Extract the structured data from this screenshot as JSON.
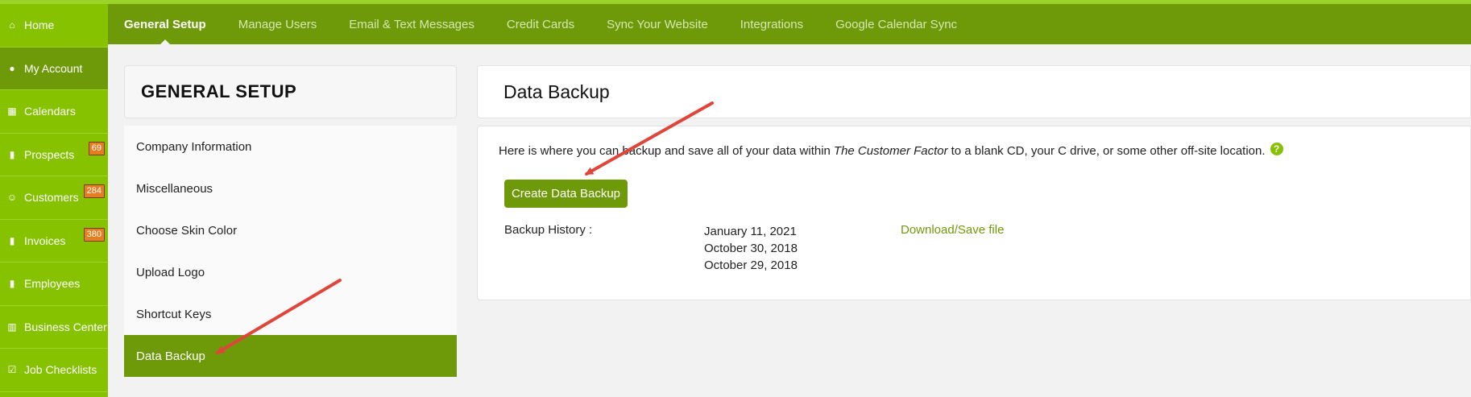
{
  "sidebar": {
    "items": [
      {
        "label": "Home",
        "icon": "home-icon",
        "glyph": "⌂"
      },
      {
        "label": "My Account",
        "icon": "user-circle-icon",
        "glyph": "●",
        "active": true
      },
      {
        "label": "Calendars",
        "icon": "calendar-icon",
        "glyph": "▦"
      },
      {
        "label": "Prospects",
        "icon": "file-icon",
        "glyph": "▮",
        "badge": "69"
      },
      {
        "label": "Customers",
        "icon": "users-icon",
        "glyph": "☺",
        "badge": "284"
      },
      {
        "label": "Invoices",
        "icon": "file-icon",
        "glyph": "▮",
        "badge": "380"
      },
      {
        "label": "Employees",
        "icon": "file-icon",
        "glyph": "▮"
      },
      {
        "label": "Business Center",
        "icon": "building-icon",
        "glyph": "▥"
      },
      {
        "label": "Job Checklists",
        "icon": "checkbox-icon",
        "glyph": "☑"
      }
    ]
  },
  "topnav": {
    "tabs": [
      {
        "label": "General Setup",
        "active": true
      },
      {
        "label": "Manage Users"
      },
      {
        "label": "Email & Text Messages"
      },
      {
        "label": "Credit Cards"
      },
      {
        "label": "Sync Your Website"
      },
      {
        "label": "Integrations"
      },
      {
        "label": "Google Calendar Sync"
      }
    ]
  },
  "left_panel": {
    "title": "GENERAL SETUP",
    "menu": [
      {
        "label": "Company Information"
      },
      {
        "label": "Miscellaneous"
      },
      {
        "label": "Choose Skin Color"
      },
      {
        "label": "Upload Logo"
      },
      {
        "label": "Shortcut Keys"
      },
      {
        "label": "Data Backup",
        "active": true
      }
    ]
  },
  "content": {
    "title": "Data Backup",
    "desc_before": "Here is where you can backup and save all of your data within",
    "desc_em": "The Customer Factor",
    "desc_after": "to a blank CD, your C drive, or some other off-site location.",
    "help_glyph": "?",
    "create_button": "Create Data Backup",
    "history_label": "Backup History :",
    "history_dates": [
      "January 11, 2021",
      "October 30, 2018",
      "October 29, 2018"
    ],
    "download_link": "Download/Save file"
  },
  "colors": {
    "sidebar_bg": "#86c200",
    "nav_bg": "#6e9a0a",
    "badge": "#e47e21",
    "arrow": "#e0453a"
  }
}
